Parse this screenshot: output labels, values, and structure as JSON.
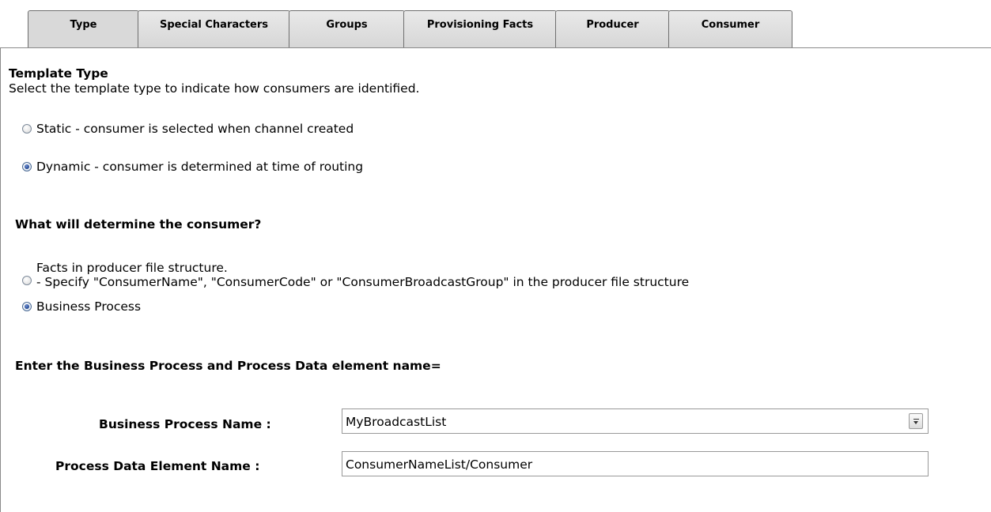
{
  "tabs": [
    {
      "label": "Type",
      "active": true
    },
    {
      "label": "Special Characters",
      "active": false
    },
    {
      "label": "Groups",
      "active": false
    },
    {
      "label": "Provisioning Facts",
      "active": false
    },
    {
      "label": "Producer",
      "active": false
    },
    {
      "label": "Consumer",
      "active": false
    }
  ],
  "template_type": {
    "heading": "Template Type",
    "description": "Select the template type to indicate how consumers are identified.",
    "options": [
      {
        "label": "Static - consumer is selected when channel created",
        "checked": false
      },
      {
        "label": "Dynamic - consumer is determined at time of routing",
        "checked": true
      }
    ]
  },
  "consumer_determination": {
    "heading": "What will determine the consumer?",
    "options": [
      {
        "label": "Facts in producer file structure.",
        "sublabel": "- Specify \"ConsumerName\", \"ConsumerCode\" or \"ConsumerBroadcastGroup\" in the producer file structure",
        "checked": false
      },
      {
        "label": "Business Process",
        "checked": true
      }
    ]
  },
  "business_process": {
    "heading": "Enter the Business Process and Process Data element name=",
    "name_label": "Business Process Name :",
    "name_value": "MyBroadcastList",
    "element_label": "Process Data Element Name :",
    "element_value": "ConsumerNameList/Consumer"
  },
  "icons": {
    "dropdown": "dropdown-arrow-icon"
  }
}
